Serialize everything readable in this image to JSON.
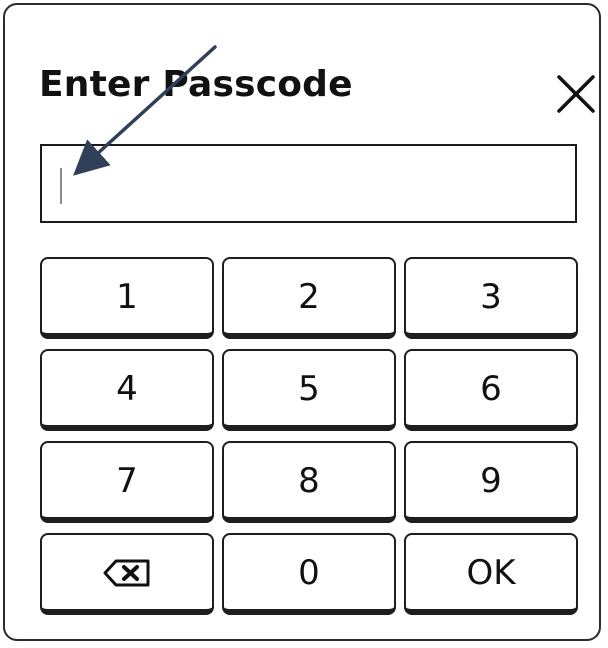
{
  "dialog": {
    "title": "Enter Passcode"
  },
  "passcode_field": {
    "value": "",
    "placeholder": ""
  },
  "keypad": {
    "keys": [
      "1",
      "2",
      "3",
      "4",
      "5",
      "6",
      "7",
      "8",
      "9",
      "",
      "0",
      "OK"
    ],
    "backspace_icon": "backspace-icon"
  },
  "icons": {
    "close": "close-icon",
    "annotation_arrow": "arrow-icon"
  },
  "colors": {
    "text": "#111111",
    "border": "#1e1e1e",
    "arrow": "#2f4058"
  }
}
